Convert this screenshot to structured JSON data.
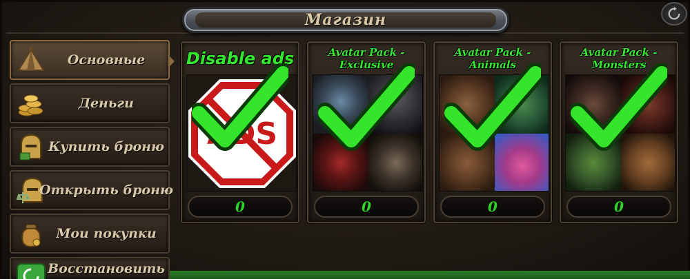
{
  "header": {
    "title": "Магазин"
  },
  "sidebar": {
    "items": [
      {
        "label": "Основные",
        "icon": "tent-icon",
        "active": true
      },
      {
        "label": "Деньги",
        "icon": "coins-icon",
        "active": false
      },
      {
        "label": "Купить броню",
        "icon": "helmet-money-icon",
        "active": false
      },
      {
        "label": "Открыть броню",
        "icon": "helmet-scale-icon",
        "active": false
      },
      {
        "label": "Мои покупки",
        "icon": "money-bag-icon",
        "active": false
      },
      {
        "label": "Восстановить",
        "icon": "restore-icon",
        "active": false
      }
    ]
  },
  "shop": {
    "cards": [
      {
        "title": "Disable ads",
        "title_line2": "",
        "price": "0",
        "purchased": true,
        "art": "no-ads-sign"
      },
      {
        "title": "Avatar Pack -",
        "title_line2": "Exclusive",
        "price": "0",
        "purchased": true,
        "art": "exclusive-avatars"
      },
      {
        "title": "Avatar Pack -",
        "title_line2": "Animals",
        "price": "0",
        "purchased": true,
        "art": "animal-avatars"
      },
      {
        "title": "Avatar Pack -",
        "title_line2": "Monsters",
        "price": "0",
        "purchased": true,
        "art": "monster-avatars"
      }
    ]
  },
  "colors": {
    "accent_green": "#33e82e",
    "label_tan": "#d7c9a9",
    "panel_bg": "#241c16"
  }
}
